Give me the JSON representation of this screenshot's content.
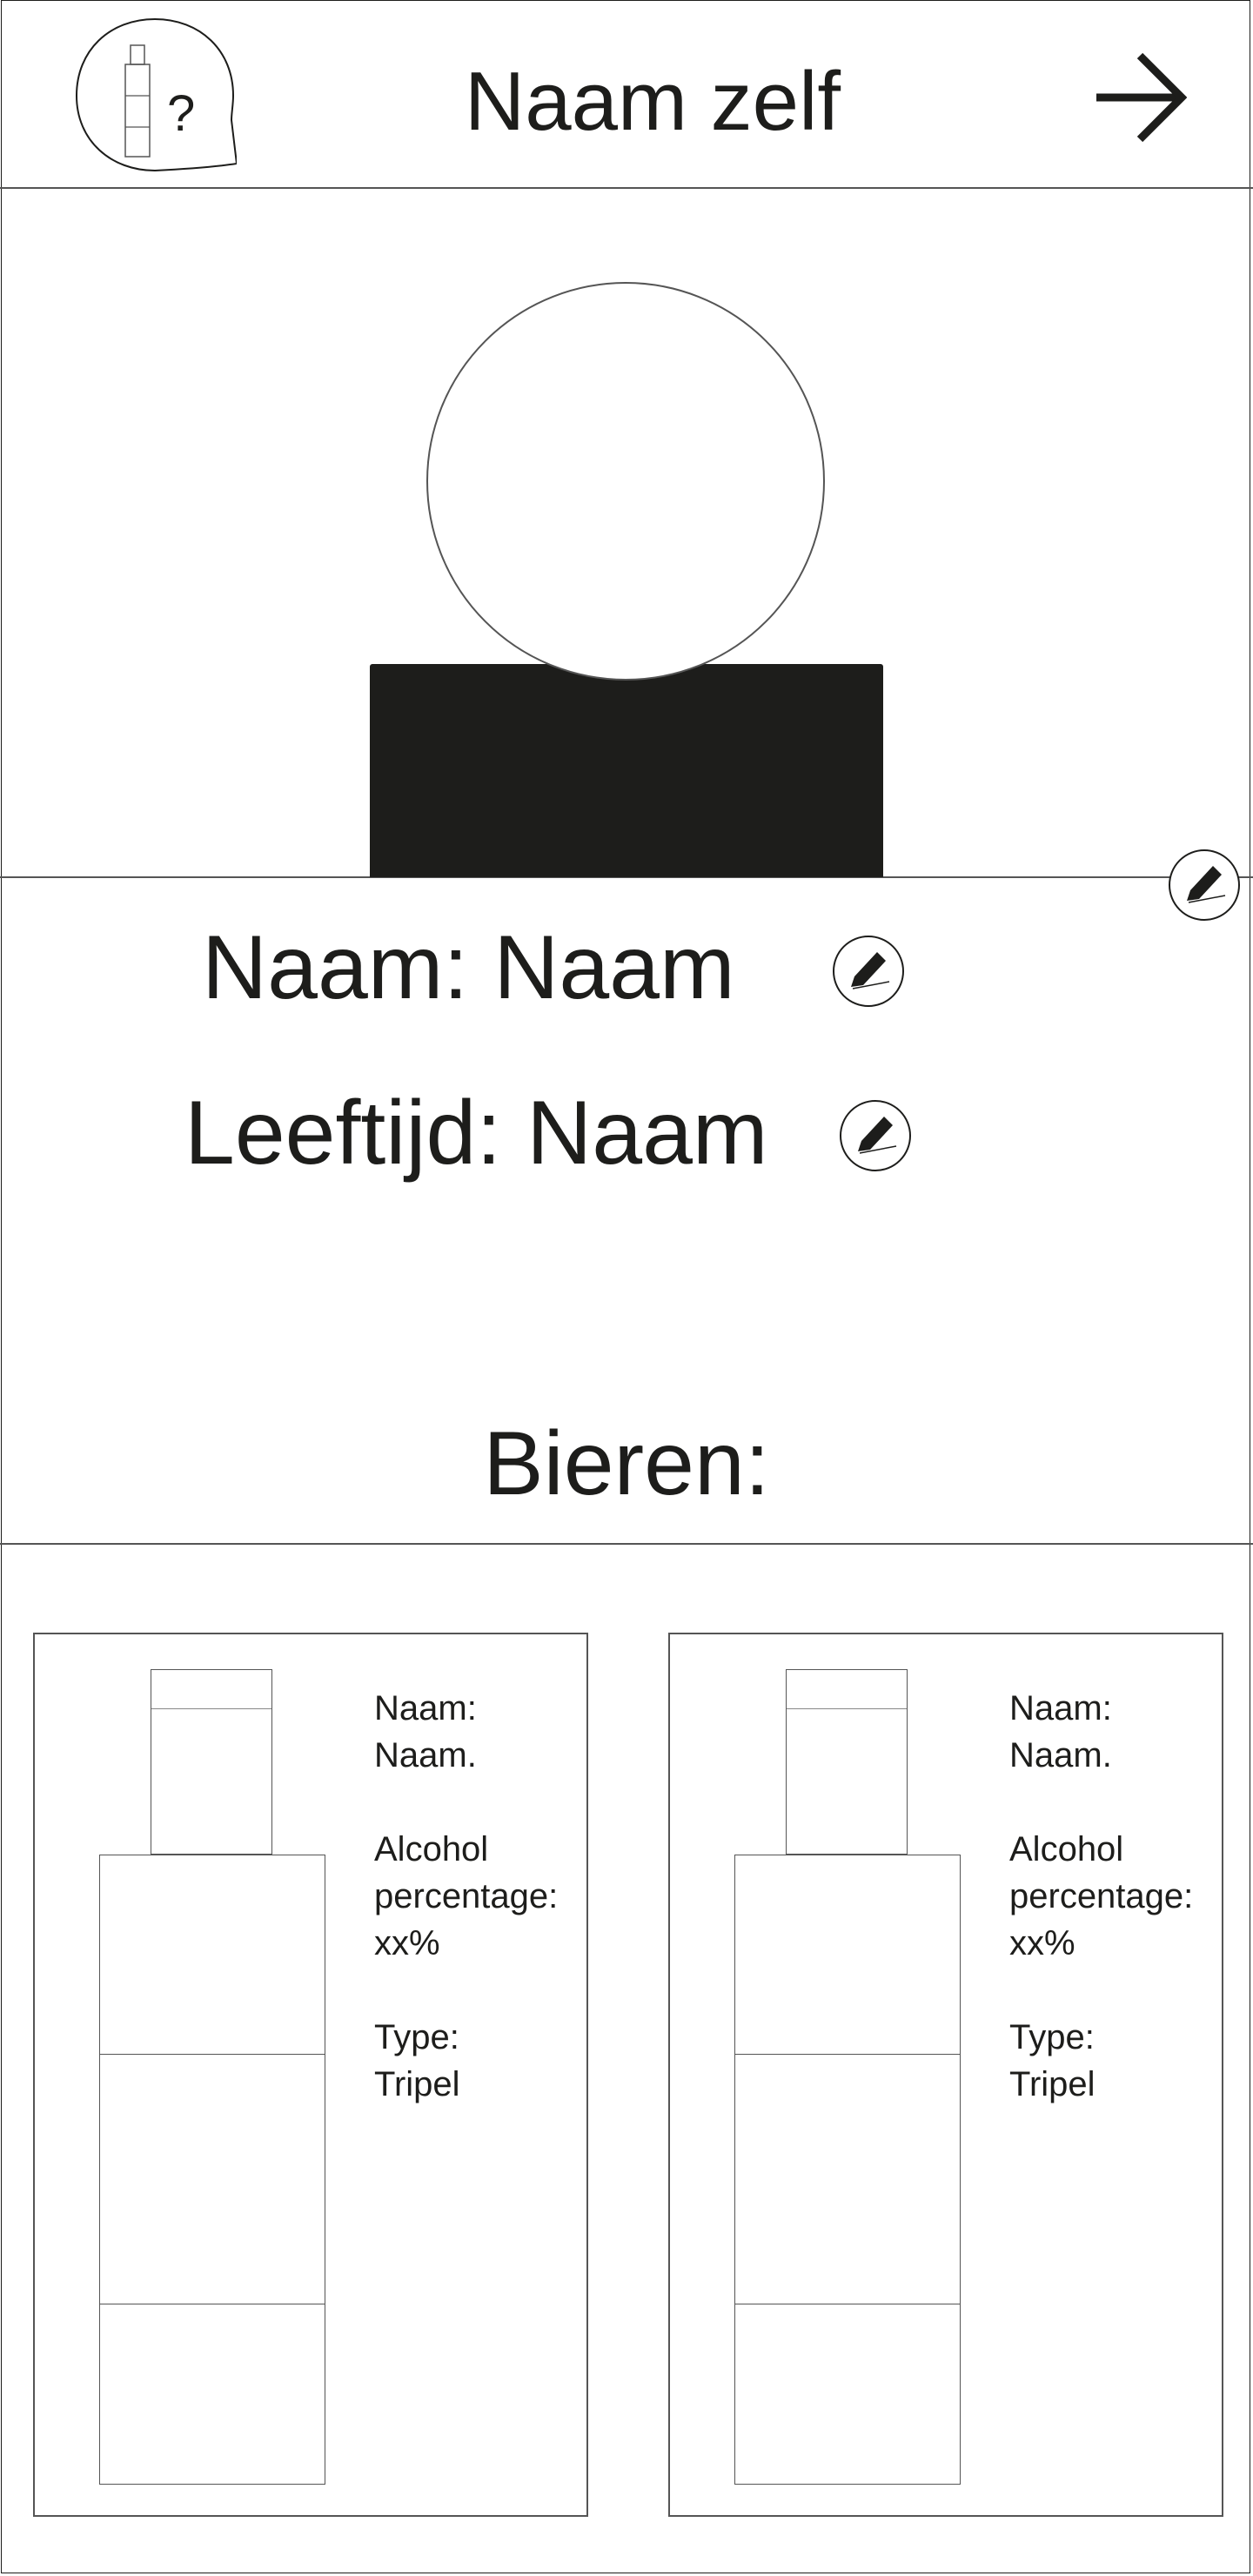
{
  "header": {
    "title": "Naam zelf",
    "help_badge_text": "?"
  },
  "profile": {
    "name_label": "Naam: Naam",
    "age_label": "Leeftijd: Naam"
  },
  "beers": {
    "title": "Bieren:",
    "items": [
      {
        "name_label": "Naam:",
        "name_value": "Naam.",
        "alcohol_label_1": "Alcohol",
        "alcohol_label_2": "percentage:",
        "alcohol_value": "xx%",
        "type_label": "Type:",
        "type_value": "Tripel"
      },
      {
        "name_label": "Naam:",
        "name_value": "Naam.",
        "alcohol_label_1": "Alcohol",
        "alcohol_label_2": "percentage:",
        "alcohol_value": "xx%",
        "type_label": "Type:",
        "type_value": "Tripel"
      }
    ]
  },
  "colors": {
    "ink": "#1d1d1b",
    "line": "#555555",
    "background": "#ffffff"
  },
  "icons": [
    "bottle-help-icon",
    "arrow-right-icon",
    "pencil-icon",
    "bottle-icon"
  ]
}
